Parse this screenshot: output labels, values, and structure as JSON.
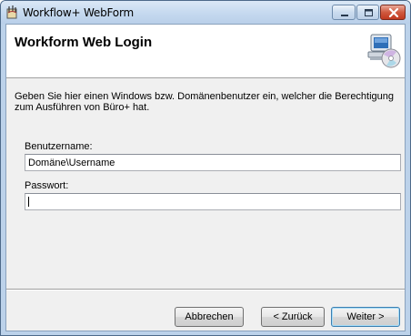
{
  "window": {
    "title": "Workflow+ WebForm",
    "app_icon": "app-icon",
    "controls": {
      "minimize_icon": "minimize-icon",
      "maximize_icon": "maximize-icon",
      "close_icon": "close-icon"
    }
  },
  "header": {
    "title": "Workform Web Login",
    "icon": "computer-cd-icon"
  },
  "body": {
    "description": "Geben Sie hier einen Windows bzw. Domänenbenutzer ein, welcher die Berechtigung zum Ausführen von Büro+ hat.",
    "username_label": "Benutzername:",
    "username_value": "Domäne\\Username",
    "password_label": "Passwort:",
    "password_value": ""
  },
  "buttons": {
    "cancel": "Abbrechen",
    "back": "< Zurück",
    "next": "Weiter >"
  }
}
